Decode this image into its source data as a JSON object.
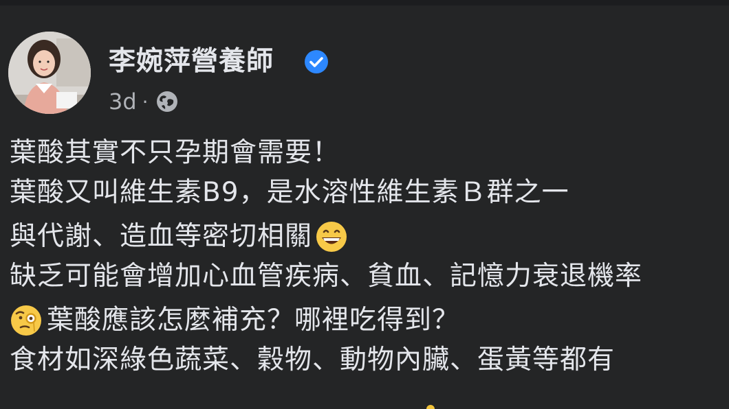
{
  "post": {
    "author_name": "李婉萍營養師",
    "verified": true,
    "timestamp": "3d",
    "separator": "·",
    "audience_icon": "globe-icon",
    "lines": [
      {
        "text": "葉酸其實不只孕期會需要！"
      },
      {
        "text": "葉酸又叫維生素B9，是水溶性維生素Ｂ群之一"
      },
      {
        "text": "與代謝、造血等密切相關",
        "trailing_icon": "grinning-face-emoji"
      },
      {
        "text": "缺乏可能會增加心血管疾病、貧血、記憶力衰退機率"
      },
      {
        "text": "葉酸應該怎麼補充？哪裡吃得到？",
        "leading_icon": "face-with-monocle-emoji"
      },
      {
        "text": "食材如深綠色蔬菜、穀物、動物內臟、蛋黃等都有"
      }
    ]
  },
  "colors": {
    "background": "#242526",
    "primary_text": "#e4e6eb",
    "secondary_text": "#b0b3b8",
    "verified_blue": "#2d88ff"
  }
}
